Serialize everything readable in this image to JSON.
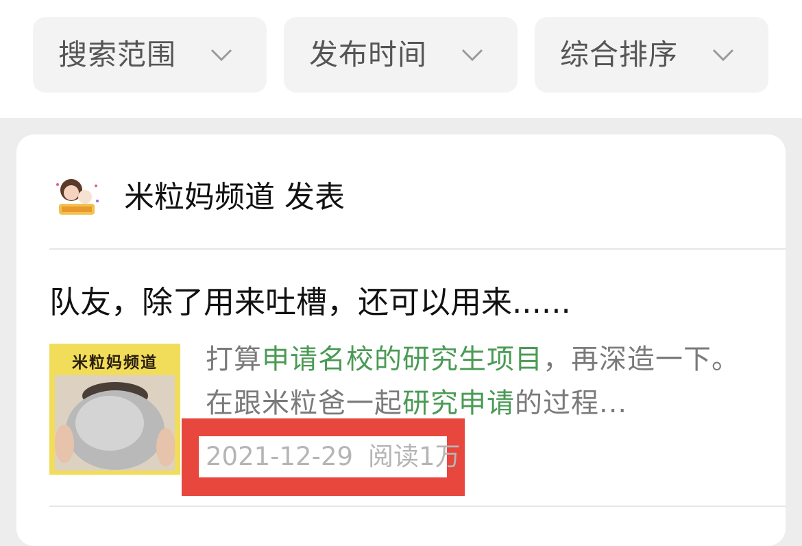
{
  "filters": [
    {
      "label": "搜索范围"
    },
    {
      "label": "发布时间"
    },
    {
      "label": "综合排序"
    }
  ],
  "article": {
    "author_line": "米粒妈频道 发表",
    "title": "队友，除了用来吐槽，还可以用来......",
    "thumbnail_banner": "米粒妈频道",
    "excerpt": {
      "part1": "打算",
      "hl1": "申请名校的研究生项目",
      "part2": "，再深造一下。在跟米粒爸一起",
      "hl2": "研究申请",
      "part3": "的过程..."
    },
    "date": "2021-12-29",
    "reads": "阅读1万"
  },
  "colors": {
    "highlight": "#4a9a54",
    "annotation_box": "#e8473e"
  },
  "icons": [
    "chevron-down-icon",
    "avatar-illustration"
  ]
}
